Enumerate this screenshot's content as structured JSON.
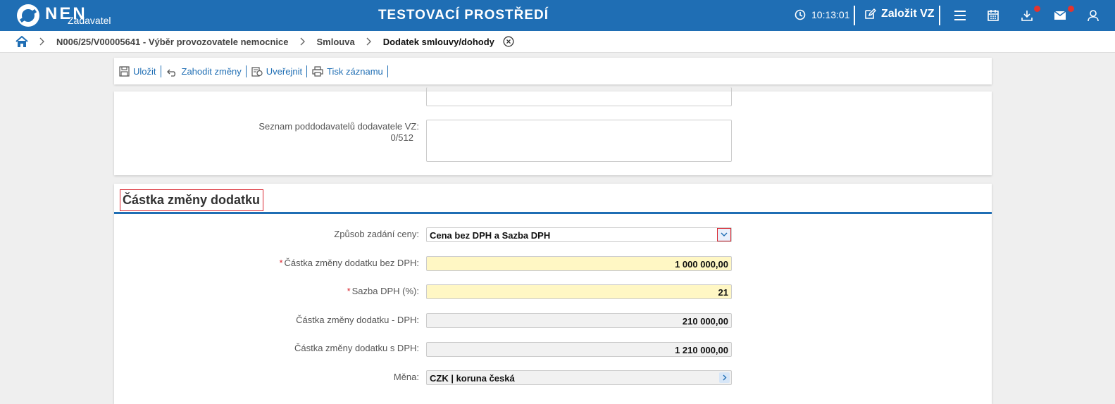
{
  "header": {
    "logo_text": "NEN",
    "logo_sub": "Zadavatel",
    "env_title": "TESTOVACÍ PROSTŘEDÍ",
    "clock": "10:13:01",
    "create_label": "Založit VZ",
    "icons": [
      "clock-icon",
      "edit-icon",
      "menu-icon",
      "calendar-icon",
      "download-icon",
      "mail-icon",
      "user-icon"
    ],
    "accent": "#1f6eb4",
    "notify_color": "#e3342f"
  },
  "breadcrumb": {
    "items": [
      "N006/25/V00005641 - Výběr provozovatele nemocnice",
      "Smlouva",
      "Dodatek smlouvy/dohody"
    ]
  },
  "toolbar": {
    "save": "Uložit",
    "discard": "Zahodit změny",
    "publish": "Uveřejnit",
    "print": "Tisk záznamu"
  },
  "subcontractors": {
    "label": "Seznam poddodavatelů dodavatele VZ:",
    "counter": "0/512",
    "value": ""
  },
  "section": {
    "title": "Částka změny dodatku",
    "fields": {
      "price_mode_label": "Způsob zadání ceny:",
      "price_mode_value": "Cena bez DPH a Sazba DPH",
      "amount_no_vat_label": "Částka změny dodatku bez DPH:",
      "amount_no_vat_value": "1 000 000,00",
      "vat_rate_label": "Sazba DPH (%):",
      "vat_rate_value": "21",
      "vat_label": "Částka změny dodatku - DPH:",
      "vat_value": "210 000,00",
      "amount_with_vat_label": "Částka změny dodatku s DPH:",
      "amount_with_vat_value": "1 210 000,00",
      "currency_label": "Měna:",
      "currency_value": "CZK | koruna česká"
    },
    "required_mark": "*"
  }
}
